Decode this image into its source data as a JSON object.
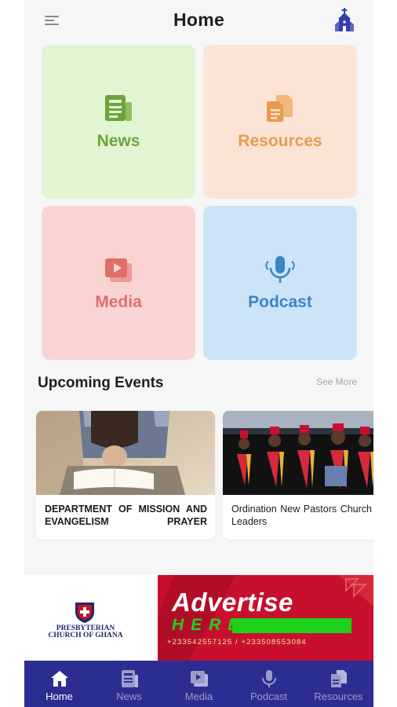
{
  "header": {
    "title": "Home",
    "menu_icon": "menu-icon",
    "action_icon": "church-icon"
  },
  "tiles": [
    {
      "label": "News",
      "icon": "news-icon",
      "color": "#6da33c",
      "bg": "#e2f5d3"
    },
    {
      "label": "Resources",
      "icon": "documents-icon",
      "color": "#e99a4a",
      "bg": "#fbe4d6"
    },
    {
      "label": "Media",
      "icon": "video-library-icon",
      "color": "#e06e6a",
      "bg": "#fad4d3"
    },
    {
      "label": "Podcast",
      "icon": "microphone-icon",
      "color": "#3b86c5",
      "bg": "#cce3f8"
    }
  ],
  "events": {
    "title": "Upcoming Events",
    "see_more": "See More",
    "items": [
      {
        "title": "DEPARTMENT OF MISSION AND EVANGELISM PRAYER"
      },
      {
        "title": "Ordination New Pastors Church Leaders"
      }
    ]
  },
  "advert": {
    "org_name_line1": "PRESBYTERIAN",
    "org_name_line2": "CHURCH OF GHANA",
    "title": "Advertise",
    "subtitle": "HERE",
    "phones": "+233542557125 / +233508553084",
    "colors": {
      "red": "#c8102e",
      "green": "#1dd11d"
    }
  },
  "bottom_nav": {
    "items": [
      {
        "label": "Home",
        "icon": "home-icon",
        "active": true
      },
      {
        "label": "News",
        "icon": "news-icon",
        "active": false
      },
      {
        "label": "Media",
        "icon": "video-library-icon",
        "active": false
      },
      {
        "label": "Podcast",
        "icon": "microphone-icon",
        "active": false
      },
      {
        "label": "Resources",
        "icon": "documents-icon",
        "active": false
      }
    ],
    "bg": "#2b2d91"
  }
}
